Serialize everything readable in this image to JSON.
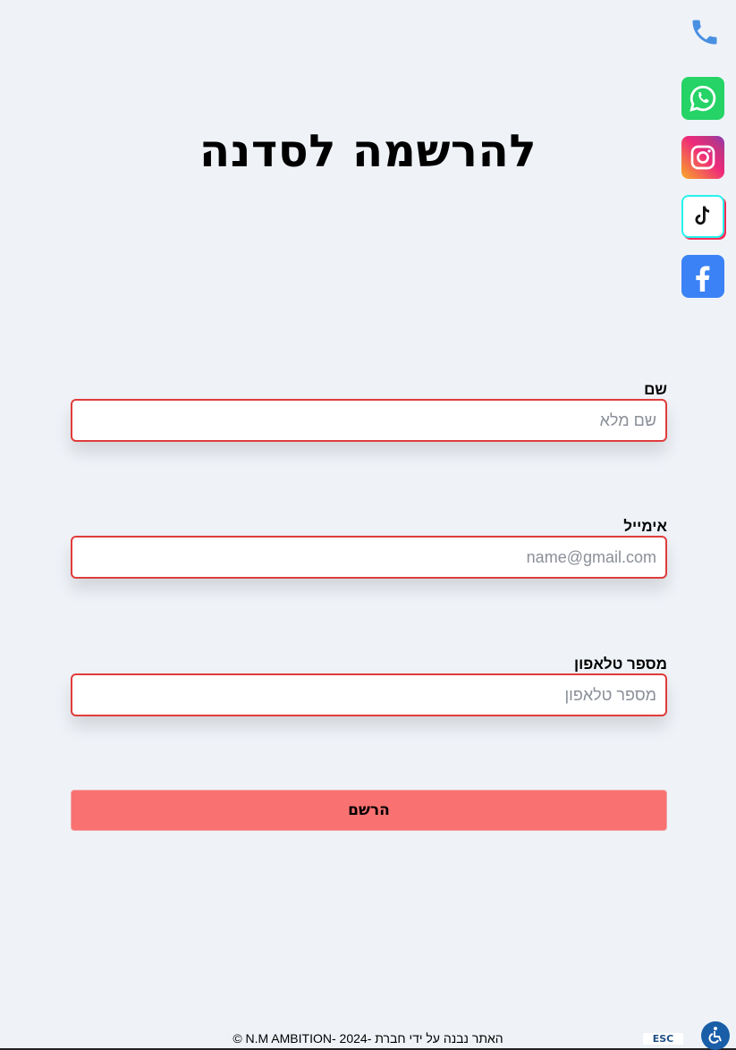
{
  "page": {
    "title": "להרשמה לסדנה"
  },
  "form": {
    "name_label": "שם",
    "name_placeholder": "שם מלא",
    "email_label": "אימייל",
    "email_placeholder": "name@gmail.com",
    "phone_label": "מספר טלאפון",
    "phone_placeholder": "מספר טלאפון",
    "submit_label": "הרשם"
  },
  "social": [
    "phone-icon",
    "whatsapp-icon",
    "instagram-icon",
    "tiktok-icon",
    "facebook-icon"
  ],
  "footer": {
    "text": "האתר נבנה על ידי חברת -N.M AMBITION- 2024 ©"
  },
  "accessibility": {
    "esc_label": "ESC"
  },
  "colors": {
    "background": "#eff3f8",
    "input_border": "#e13c3c",
    "submit_bg": "#f97171"
  }
}
